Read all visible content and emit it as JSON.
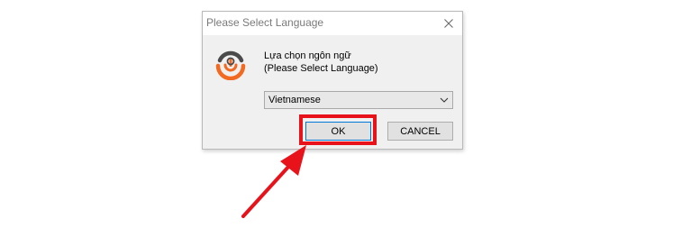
{
  "dialog": {
    "title": "Please Select Language",
    "message_line1": "Lựa chọn ngôn ngữ",
    "message_line2": "(Please Select Language)",
    "language_select": {
      "selected": "Vietnamese"
    },
    "ok_label": "OK",
    "cancel_label": "CANCEL"
  },
  "icons": {
    "close": "close-icon",
    "app_logo": "app-logo-icon",
    "dropdown": "chevron-down-icon",
    "pointer_arrow": "red-arrow-annotation"
  },
  "colors": {
    "annotation_red": "#e8121a",
    "logo_orange": "#f26a21",
    "logo_dark": "#4a4a4a"
  }
}
